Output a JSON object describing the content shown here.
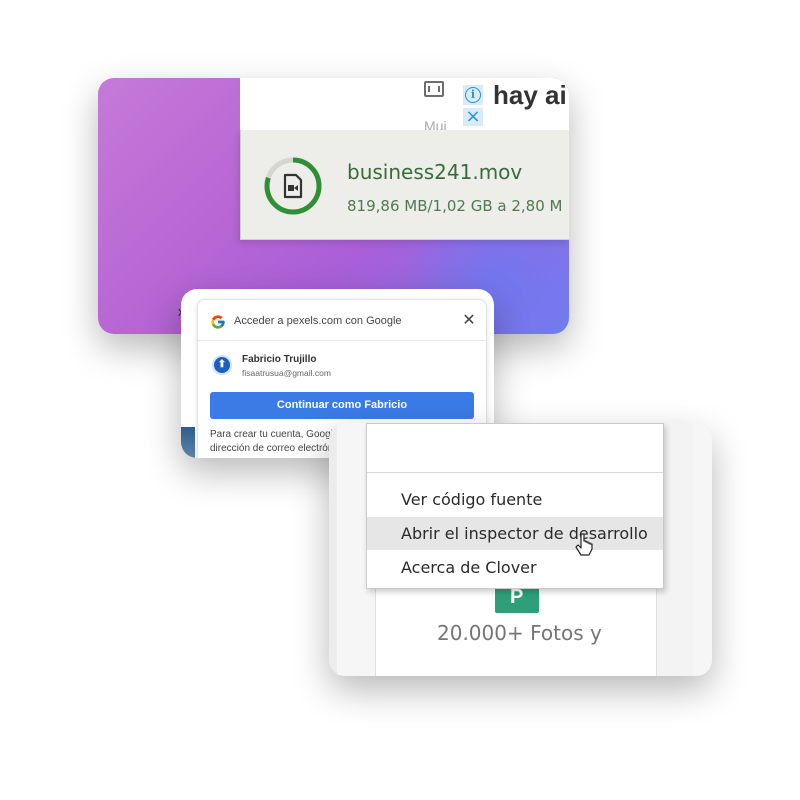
{
  "download_card": {
    "ad_text": "hay ai",
    "faded_text": "Mui",
    "filename": "business241.mov",
    "status": "819,86 MB/1,02 GB a 2,80 M",
    "progress_fraction": 0.8,
    "fragment_text": "xpl",
    "icons": [
      "film-icon",
      "info-icon",
      "close-ad-icon",
      "video-file-icon"
    ]
  },
  "google_card": {
    "title": "Acceder a pexels.com con Google",
    "close": "✕",
    "user_name": "Fabricio Trujillo",
    "user_email": "fisaatrusua@gmail.com",
    "button_label": "Continuar como Fabricio",
    "description": "Para crear tu cuenta, Google compartirá tu nombre, dirección de correo electrónico y foto de perfil con"
  },
  "context_card": {
    "menu_items": [
      {
        "label": "Ver código fuente",
        "highlighted": false
      },
      {
        "label": "Abrir el inspector de desarrollo",
        "highlighted": true
      },
      {
        "label": "Acerca de Clover",
        "highlighted": false
      }
    ],
    "caption": "20.000+ Fotos y",
    "logo_letter": "P"
  },
  "colors": {
    "accent_green": "#2e9f79",
    "google_blue": "#3b7be6",
    "download_text": "#3a6b3c"
  }
}
